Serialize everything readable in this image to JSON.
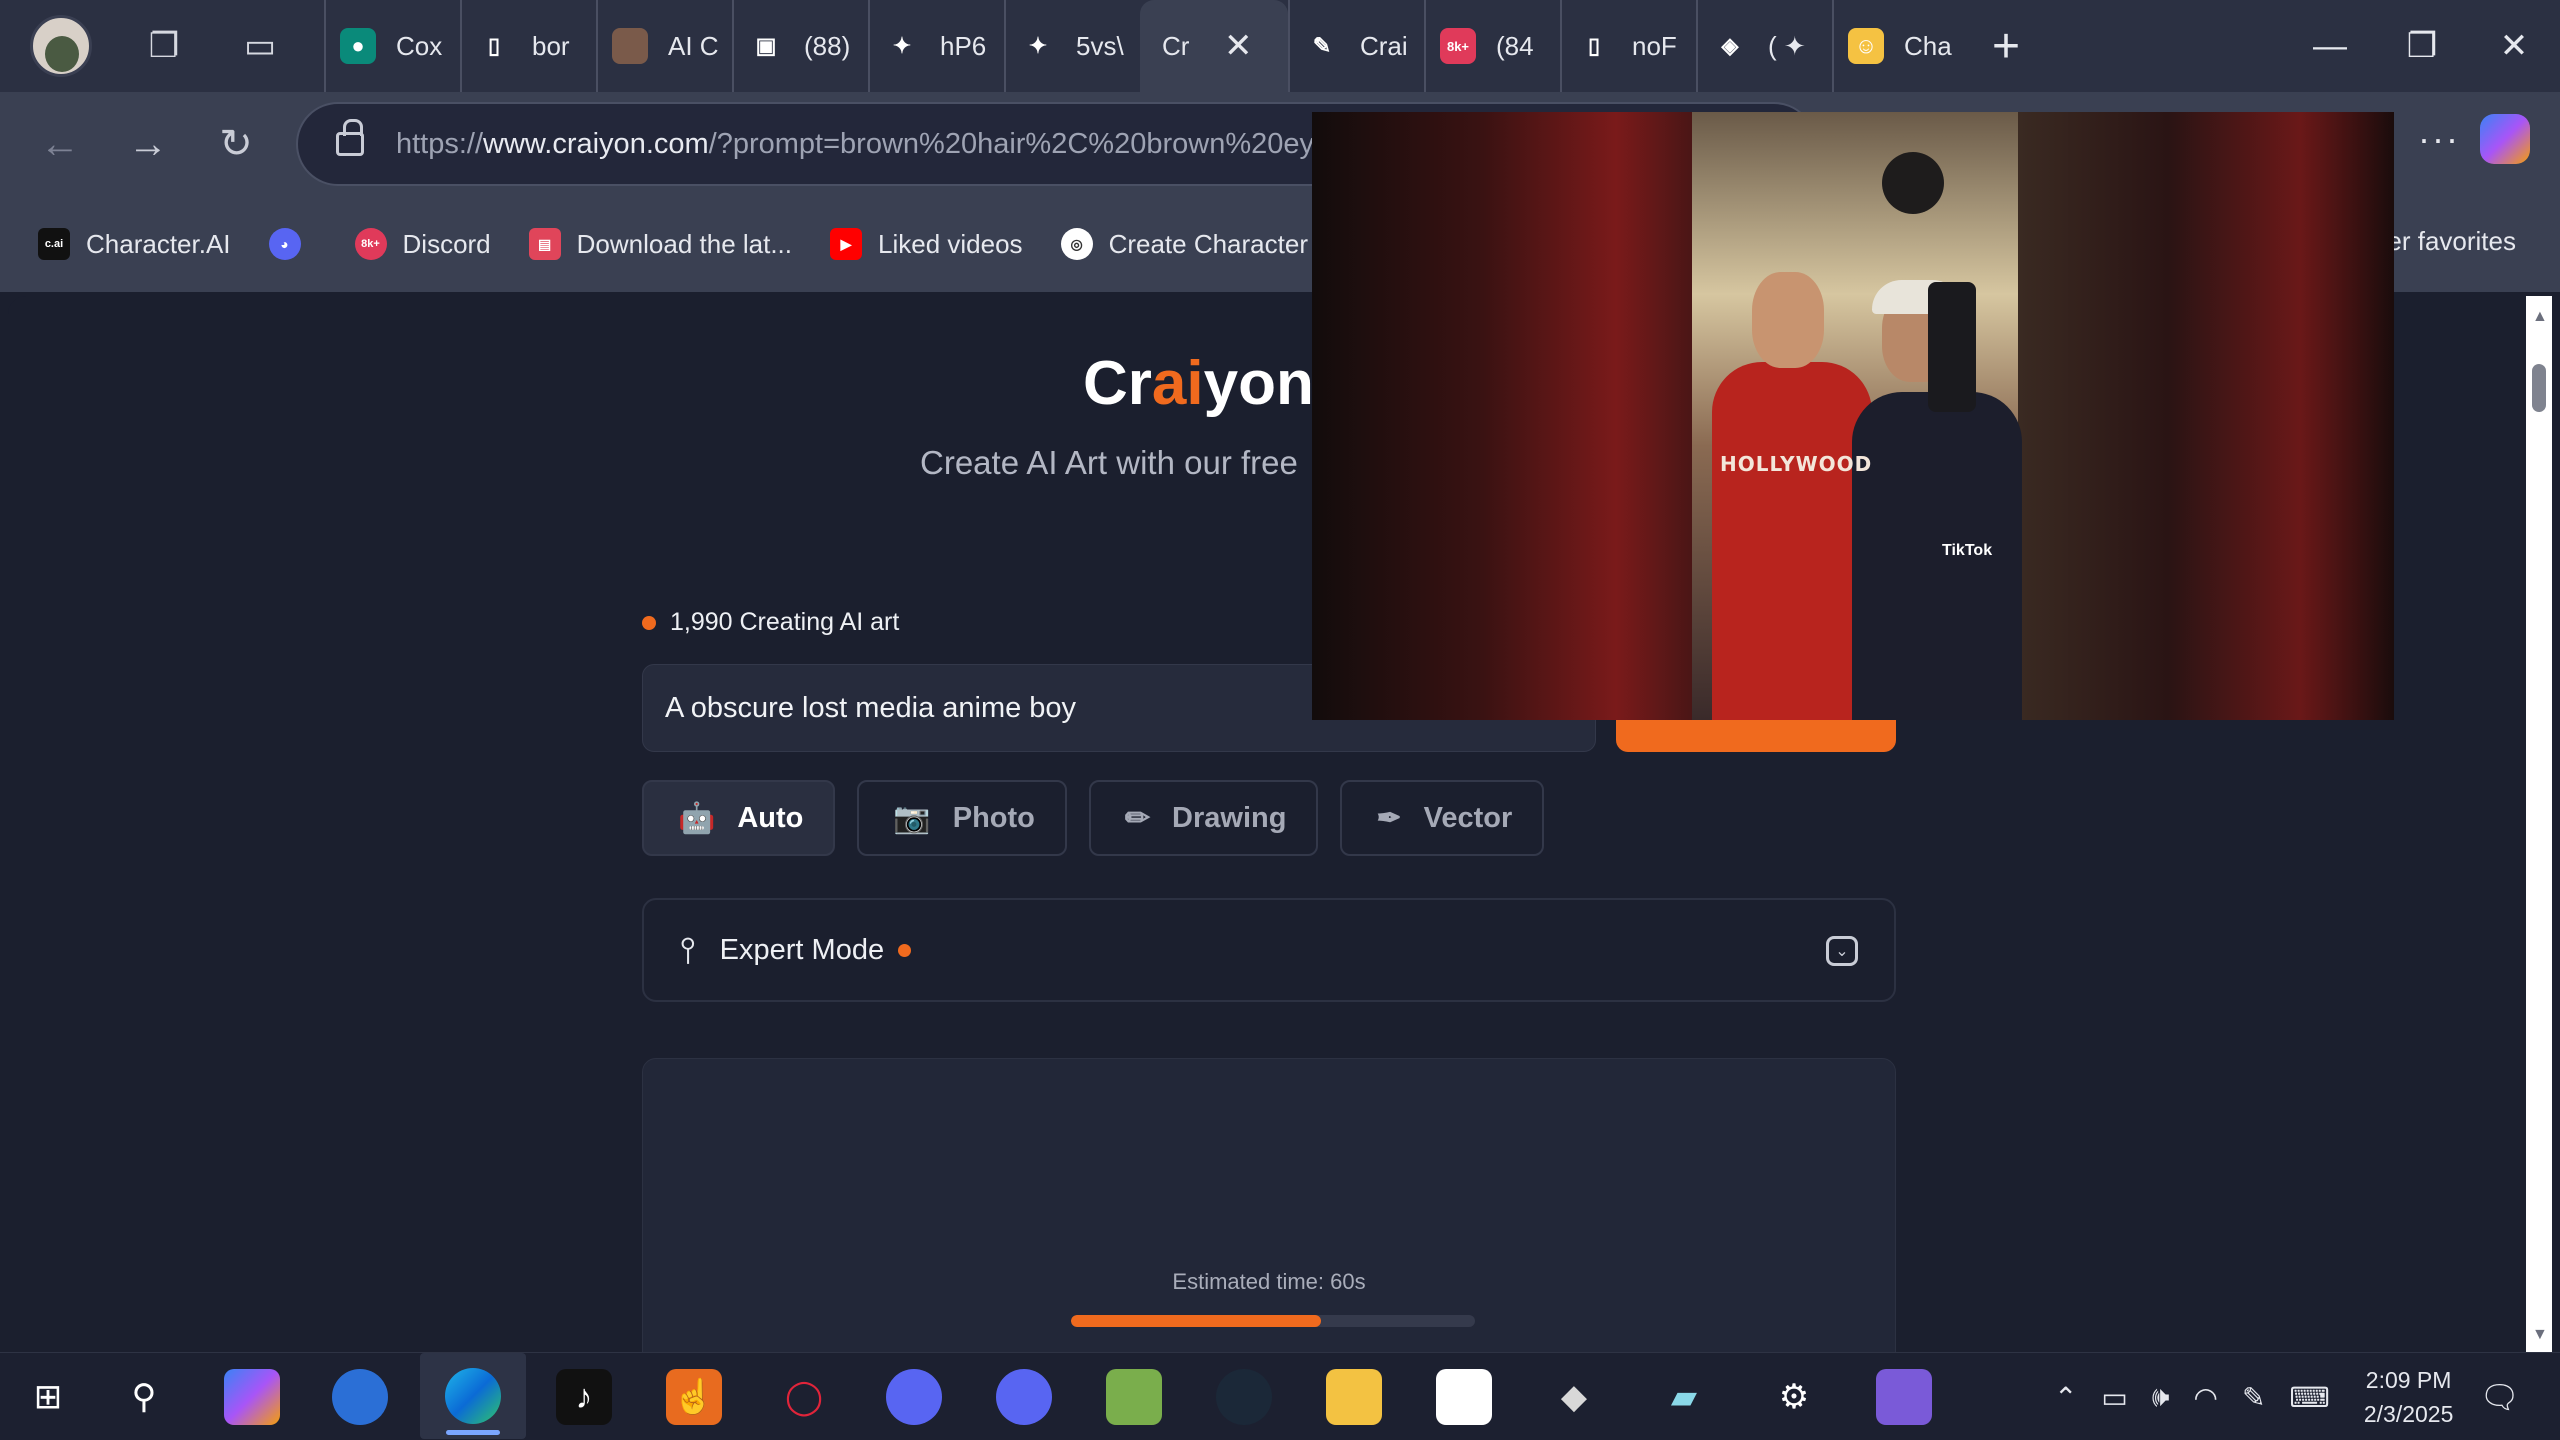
{
  "browser": {
    "tabs": [
      {
        "label": "Cox",
        "color": "#0a8a7a",
        "glyph": "●"
      },
      {
        "label": "bor",
        "color": "transparent",
        "glyph": "▯"
      },
      {
        "label": "AI C",
        "color": "#7a5a4a",
        "glyph": ""
      },
      {
        "label": "(88)",
        "color": "transparent",
        "glyph": "▣"
      },
      {
        "label": "hP6",
        "color": "transparent",
        "glyph": "✦"
      },
      {
        "label": "5vs\\",
        "color": "transparent",
        "glyph": "✦"
      },
      {
        "label": "Cr",
        "color": "transparent",
        "glyph": "",
        "active": true
      },
      {
        "label": "Crai",
        "color": "transparent",
        "glyph": "✎"
      },
      {
        "label": "(84",
        "color": "#e03a5a",
        "glyph": "8k+"
      },
      {
        "label": "noF",
        "color": "transparent",
        "glyph": "▯"
      },
      {
        "label": "( ✦",
        "color": "transparent",
        "glyph": "◈"
      },
      {
        "label": "Cha",
        "color": "#f5c242",
        "glyph": "☺"
      }
    ],
    "url_prefix": "https://",
    "url_domain": "www.craiyon.com",
    "url_path": "/?prompt=brown%20hair%2C%20brown%20eyes",
    "favorites": [
      {
        "label": "Character.AI",
        "icon": "c.ai",
        "color": "#111111"
      },
      {
        "label": "",
        "icon": "discord",
        "color": "#5865f2"
      },
      {
        "label": "Discord",
        "icon": "8k+",
        "color": "#e03a5a"
      },
      {
        "label": "Download the lat...",
        "icon": "store",
        "color": "#e0455a"
      },
      {
        "label": "Liked videos",
        "icon": "youtube",
        "color": "#ff0000"
      },
      {
        "label": "Create Character",
        "icon": "openai",
        "color": "#ffffff"
      }
    ],
    "other_favorites": "her favorites"
  },
  "craiyon": {
    "logo_pre": "Cr",
    "logo_accent": "ai",
    "logo_post": "yon",
    "subtitle": "Create AI Art with our free",
    "status": "1,990 Creating AI art",
    "prompt": "A obscure lost media anime boy",
    "modes": [
      {
        "label": "Auto",
        "icon": "🤖",
        "selected": true
      },
      {
        "label": "Photo",
        "icon": "📷",
        "selected": false
      },
      {
        "label": "Drawing",
        "icon": "✏",
        "selected": false
      },
      {
        "label": "Vector",
        "icon": "✒",
        "selected": false
      }
    ],
    "expert_mode": "Expert Mode",
    "estimate": "Estimated time: 60s",
    "progress_fraction": 0.62,
    "accent_color": "#f06a1e"
  },
  "pip_video": {
    "shirt_text": "HOLLYWOOD",
    "watermark": "TikTok"
  },
  "taskbar": {
    "time": "2:09 PM",
    "date": "2/3/2025"
  }
}
